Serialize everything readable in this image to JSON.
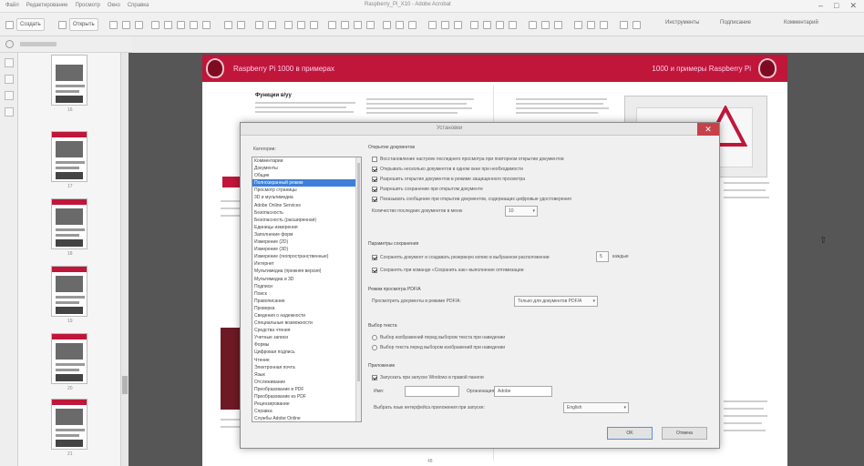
{
  "titlebar": {
    "menu": [
      "Файл",
      "Редактирование",
      "Просмотр",
      "Окно",
      "Справка"
    ],
    "title": "Raspberry_Pi_X10 - Adobe Acrobat"
  },
  "toolbar": {
    "open_label": "Открыть",
    "create_label": "Создать",
    "trail_right": "Инструменты",
    "trail_right2": "Подписание",
    "trail_right3": "Комментарий"
  },
  "thumbnails": [
    {
      "num": "16"
    },
    {
      "num": "17"
    },
    {
      "num": "18"
    },
    {
      "num": "19"
    },
    {
      "num": "20"
    },
    {
      "num": "21"
    }
  ],
  "document": {
    "header_left": "Raspberry Pi 1000 в примерах",
    "header_right": "1000 и примеры Raspberry Pi",
    "heading": "Функции в/уу",
    "page_number": "48"
  },
  "dialog": {
    "title": "Установки",
    "close_glyph": "✕",
    "categories_label": "Категории:",
    "categories": [
      "Комментарии",
      "Документы",
      "Общие",
      "Полноэкранный режим",
      "Просмотр страницы",
      "3D и мультимедиа",
      "Adobe Online Services",
      "Безопасность",
      "Безопасность (расширенная)",
      "Единицы измерения",
      "Заполнение форм",
      "Измерение (2D)",
      "Измерение (3D)",
      "Измерение (геопространственные)",
      "Интернет",
      "Мультимедиа (прежняя версия)",
      "Мультимедиа и 3D",
      "Подписи",
      "Поиск",
      "Правописание",
      "Проверка",
      "Сведения о надежности",
      "Специальные возможности",
      "Средства чтения",
      "Учетные записи",
      "Формы",
      "Цифровая подпись",
      "Чтение",
      "Электронная почта",
      "Язык",
      "Отслеживание",
      "Преобразование в PDF",
      "Преобразование из PDF",
      "Рецензирование",
      "Справка",
      "Службы Adobe Online"
    ],
    "selected_category_index": 3,
    "sections": {
      "open": "Открытие документов",
      "pdfa": "Режим просмотра PDF/A",
      "save": "Параметры сохранения",
      "text": "Выбор текста",
      "app_start": "Приложение"
    },
    "options": [
      {
        "label": "Восстановление настроек последнего просмотра при повторном открытии документов",
        "checked": false
      },
      {
        "label": "Открывать несколько документов в одном окне при необходимости",
        "checked": true
      },
      {
        "label": "Разрешить открытие документов в режиме защищенного просмотра",
        "checked": true
      },
      {
        "label": "Разрешить сохранение при открытом документе",
        "checked": true
      },
      {
        "label": "Показывать сообщение при открытии документов, содержащих цифровые удостоверения",
        "checked": true
      }
    ],
    "recent_label": "Количество последних документов в меню",
    "recent_value": "10",
    "save_options": [
      {
        "label": "Сохранять документ и создавать резервную копию в выбранном расположении",
        "checked": true
      },
      {
        "label": "Сохранять при команде «Сохранить как» выполнение оптимизации",
        "checked": true
      }
    ],
    "save_toggle_label": "каждые",
    "save_minutes": "5",
    "pdfa_label": "Просмотреть документы в режиме PDF/A:",
    "pdfa_value": "Только для документов PDF/A",
    "text_options": [
      {
        "label": "Выбор изображений перед выбором текста при наведении",
        "checked": false
      },
      {
        "label": "Выбор текста перед выбором изображений при наведении",
        "checked": false
      }
    ],
    "app_option": {
      "label": "Запускать при запуске Windows в правой панели",
      "checked": true
    },
    "name_label": "Имя:",
    "name_value": "",
    "org_label": "Организация:",
    "org_value": "Adobe",
    "lang_label": "Выбрать язык интерфейса приложения при запуске:",
    "lang_value": "English",
    "ok_label": "OK",
    "cancel_label": "Отмена"
  },
  "colors": {
    "brand": "#c0163a",
    "selection": "#3d7fd8",
    "close_button": "#c6424a"
  }
}
